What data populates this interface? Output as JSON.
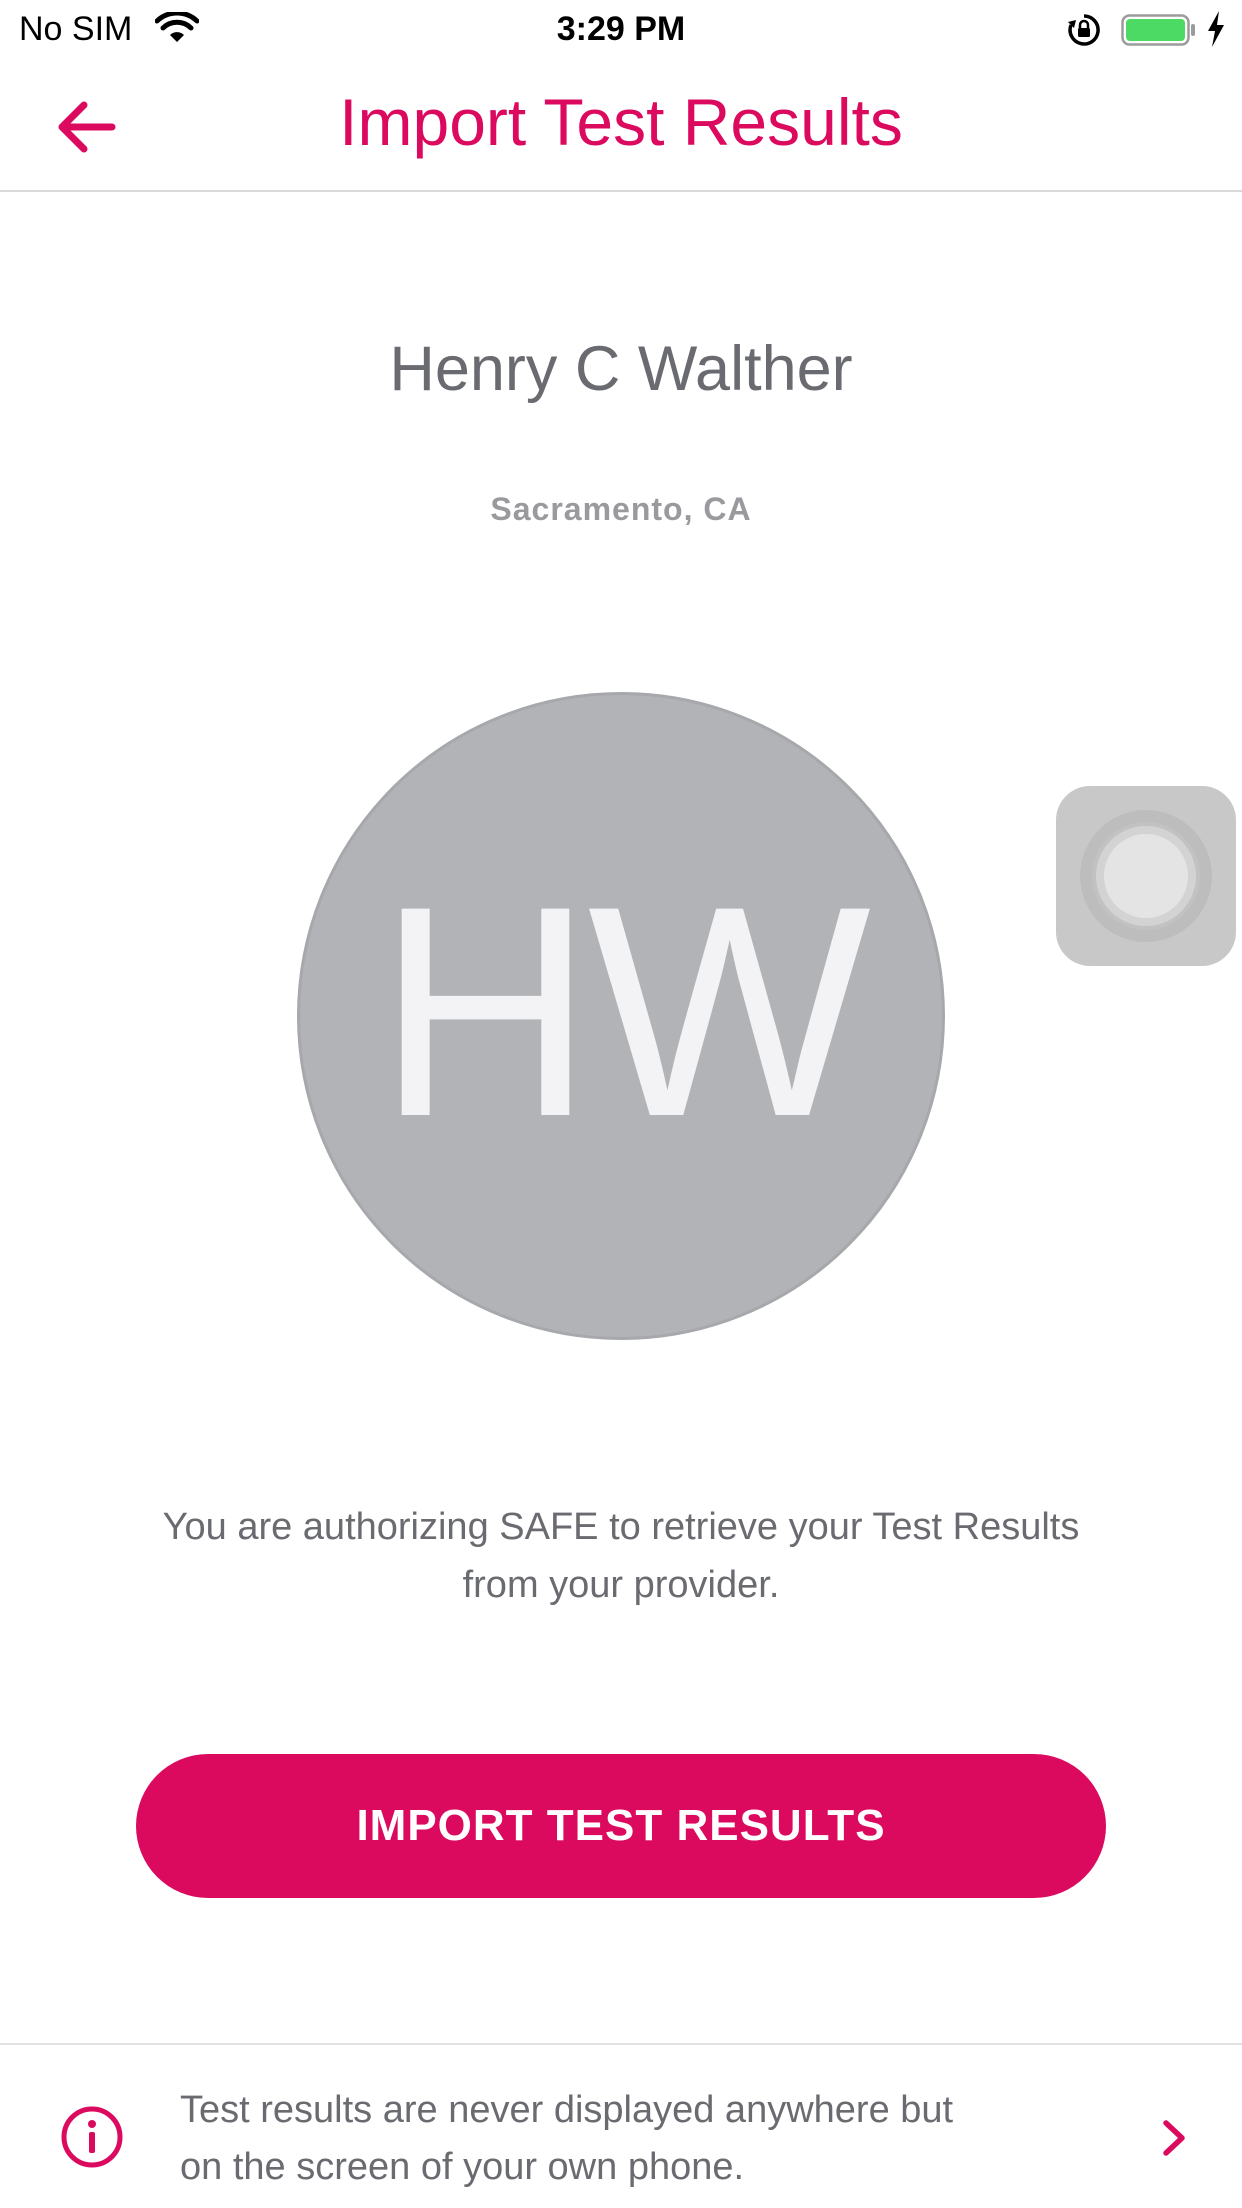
{
  "status_bar": {
    "carrier": "No SIM",
    "time": "3:29 PM",
    "battery_color": "#4cd964"
  },
  "nav": {
    "title": "Import Test Results",
    "back_icon": "arrow-left-icon"
  },
  "profile": {
    "name": "Henry C Walther",
    "location": "Sacramento, CA",
    "initials": "HW"
  },
  "authorization_text": "You are authorizing SAFE to retrieve your Test Results from your provider.",
  "import_button_label": "IMPORT TEST RESULTS",
  "info": {
    "text": "Test results are never displayed anywhere but on the screen of your own phone.",
    "icon": "info-icon"
  },
  "colors": {
    "accent": "#dc0a5f",
    "avatar_bg": "#b1b3b7",
    "text_gray": "#6a6b70"
  }
}
